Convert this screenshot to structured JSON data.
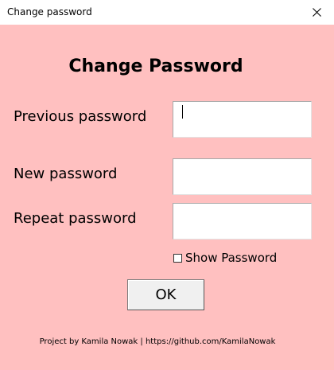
{
  "window": {
    "title": "Change password",
    "background": "#ffc0c0",
    "close_icon": "close-icon"
  },
  "heading": "Change Password",
  "fields": {
    "previous": {
      "label": "Previous password",
      "value": ""
    },
    "new": {
      "label": "New password",
      "value": ""
    },
    "repeat": {
      "label": "Repeat password",
      "value": ""
    }
  },
  "show_password": {
    "label": "Show Password",
    "checked": false
  },
  "ok_label": "OK",
  "footer": "Project by Kamila Nowak | https://github.com/KamilaNowak"
}
